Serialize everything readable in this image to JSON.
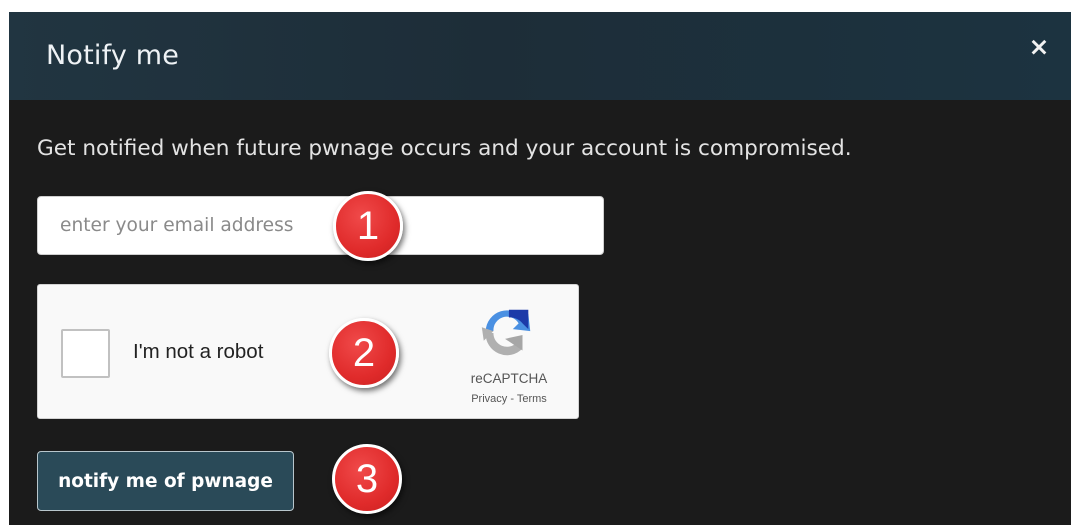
{
  "dialog": {
    "title": "Notify me",
    "close_glyph": "×",
    "close_icon": "close-icon"
  },
  "intro_text": "Get notified when future pwnage occurs and your account is compromised.",
  "email": {
    "value": "",
    "placeholder": "enter your email address"
  },
  "captcha": {
    "checked": false,
    "label": "I'm not a robot",
    "brand": "reCAPTCHA",
    "privacy_link": "Privacy",
    "separator": " - ",
    "terms_link": "Terms",
    "icon": "recaptcha-logo-icon"
  },
  "submit": {
    "label": "notify me of pwnage"
  },
  "step_badges": [
    "1",
    "2",
    "3"
  ],
  "colors": {
    "modal_background": "#1b1b1b",
    "header_background": "#213541",
    "button_background": "#2a4a58",
    "badge_red": "#e02b2b",
    "recaptcha_blue": "#1c3aa9",
    "recaptcha_light_blue": "#4a90e2",
    "recaptcha_gray": "#b0b0b0"
  }
}
